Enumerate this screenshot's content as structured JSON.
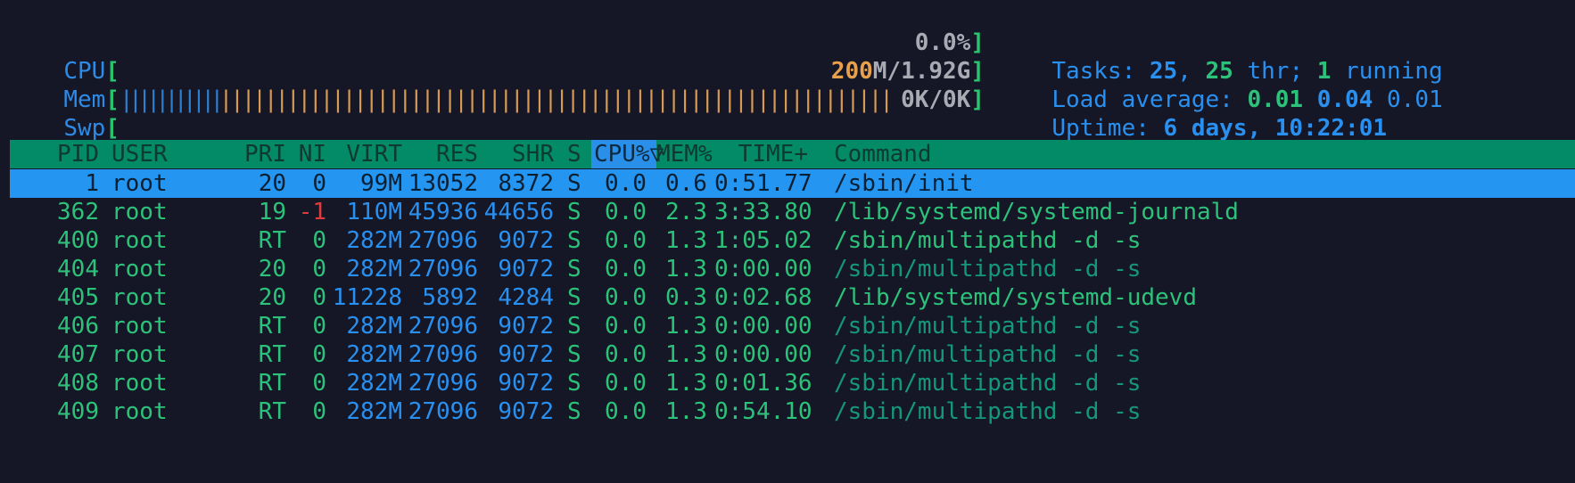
{
  "meters": {
    "cpu": {
      "label": "CPU",
      "value": "0.0%"
    },
    "mem": {
      "label": "Mem",
      "bar_blue": "|||||||||||",
      "bar_orange": "||||||||||||||||||||||||||||||||||||||||||||||||||||||||||||",
      "used": "200",
      "value_rest": "M/1.92G"
    },
    "swp": {
      "label": "Swp",
      "value": "0K/0K"
    }
  },
  "summary": {
    "tasks_label": "Tasks: ",
    "tasks": "25",
    "sep1": ", ",
    "threads": "25",
    "thr_label": " thr; ",
    "running": "1",
    "running_label": " running",
    "load_label": "Load average: ",
    "load1": "0.01",
    "load5": "0.04",
    "load15": "0.01",
    "uptime_label": "Uptime: ",
    "uptime": "6 days, 10:22:01"
  },
  "columns": [
    "PID",
    "USER",
    "PRI",
    "NI",
    "VIRT",
    "RES",
    "SHR",
    "S",
    "CPU%▽",
    "MEM%",
    "TIME+",
    "Command"
  ],
  "processes": [
    {
      "pid": "1",
      "user": "root",
      "pri": "20",
      "ni": "0",
      "virt": "99M",
      "res": "13052",
      "shr": "8372",
      "s": "S",
      "cpu": "0.0",
      "mem": "0.6",
      "time": "0:51.77",
      "cmd": "/sbin/init"
    },
    {
      "pid": "362",
      "user": "root",
      "pri": "19",
      "ni": "-1",
      "virt": "110M",
      "res": "45936",
      "shr": "44656",
      "s": "S",
      "cpu": "0.0",
      "mem": "2.3",
      "time": "3:33.80",
      "cmd": "/lib/systemd/systemd-journald"
    },
    {
      "pid": "400",
      "user": "root",
      "pri": "RT",
      "ni": "0",
      "virt": "282M",
      "res": "27096",
      "shr": "9072",
      "s": "S",
      "cpu": "0.0",
      "mem": "1.3",
      "time": "1:05.02",
      "cmd": "/sbin/multipathd -d -s"
    },
    {
      "pid": "404",
      "user": "root",
      "pri": "20",
      "ni": "0",
      "virt": "282M",
      "res": "27096",
      "shr": "9072",
      "s": "S",
      "cpu": "0.0",
      "mem": "1.3",
      "time": "0:00.00",
      "cmd": "/sbin/multipathd -d -s"
    },
    {
      "pid": "405",
      "user": "root",
      "pri": "20",
      "ni": "0",
      "virt": "11228",
      "res": "5892",
      "shr": "4284",
      "s": "S",
      "cpu": "0.0",
      "mem": "0.3",
      "time": "0:02.68",
      "cmd": "/lib/systemd/systemd-udevd"
    },
    {
      "pid": "406",
      "user": "root",
      "pri": "RT",
      "ni": "0",
      "virt": "282M",
      "res": "27096",
      "shr": "9072",
      "s": "S",
      "cpu": "0.0",
      "mem": "1.3",
      "time": "0:00.00",
      "cmd": "/sbin/multipathd -d -s"
    },
    {
      "pid": "407",
      "user": "root",
      "pri": "RT",
      "ni": "0",
      "virt": "282M",
      "res": "27096",
      "shr": "9072",
      "s": "S",
      "cpu": "0.0",
      "mem": "1.3",
      "time": "0:00.00",
      "cmd": "/sbin/multipathd -d -s"
    },
    {
      "pid": "408",
      "user": "root",
      "pri": "RT",
      "ni": "0",
      "virt": "282M",
      "res": "27096",
      "shr": "9072",
      "s": "S",
      "cpu": "0.0",
      "mem": "1.3",
      "time": "0:01.36",
      "cmd": "/sbin/multipathd -d -s"
    },
    {
      "pid": "409",
      "user": "root",
      "pri": "RT",
      "ni": "0",
      "virt": "282M",
      "res": "27096",
      "shr": "9072",
      "s": "S",
      "cpu": "0.0",
      "mem": "1.3",
      "time": "0:54.10",
      "cmd": "/sbin/multipathd -d -s"
    }
  ],
  "colors": {
    "header_bg": "#038a67",
    "selected_bg": "#2496f2",
    "background": "#151726"
  }
}
